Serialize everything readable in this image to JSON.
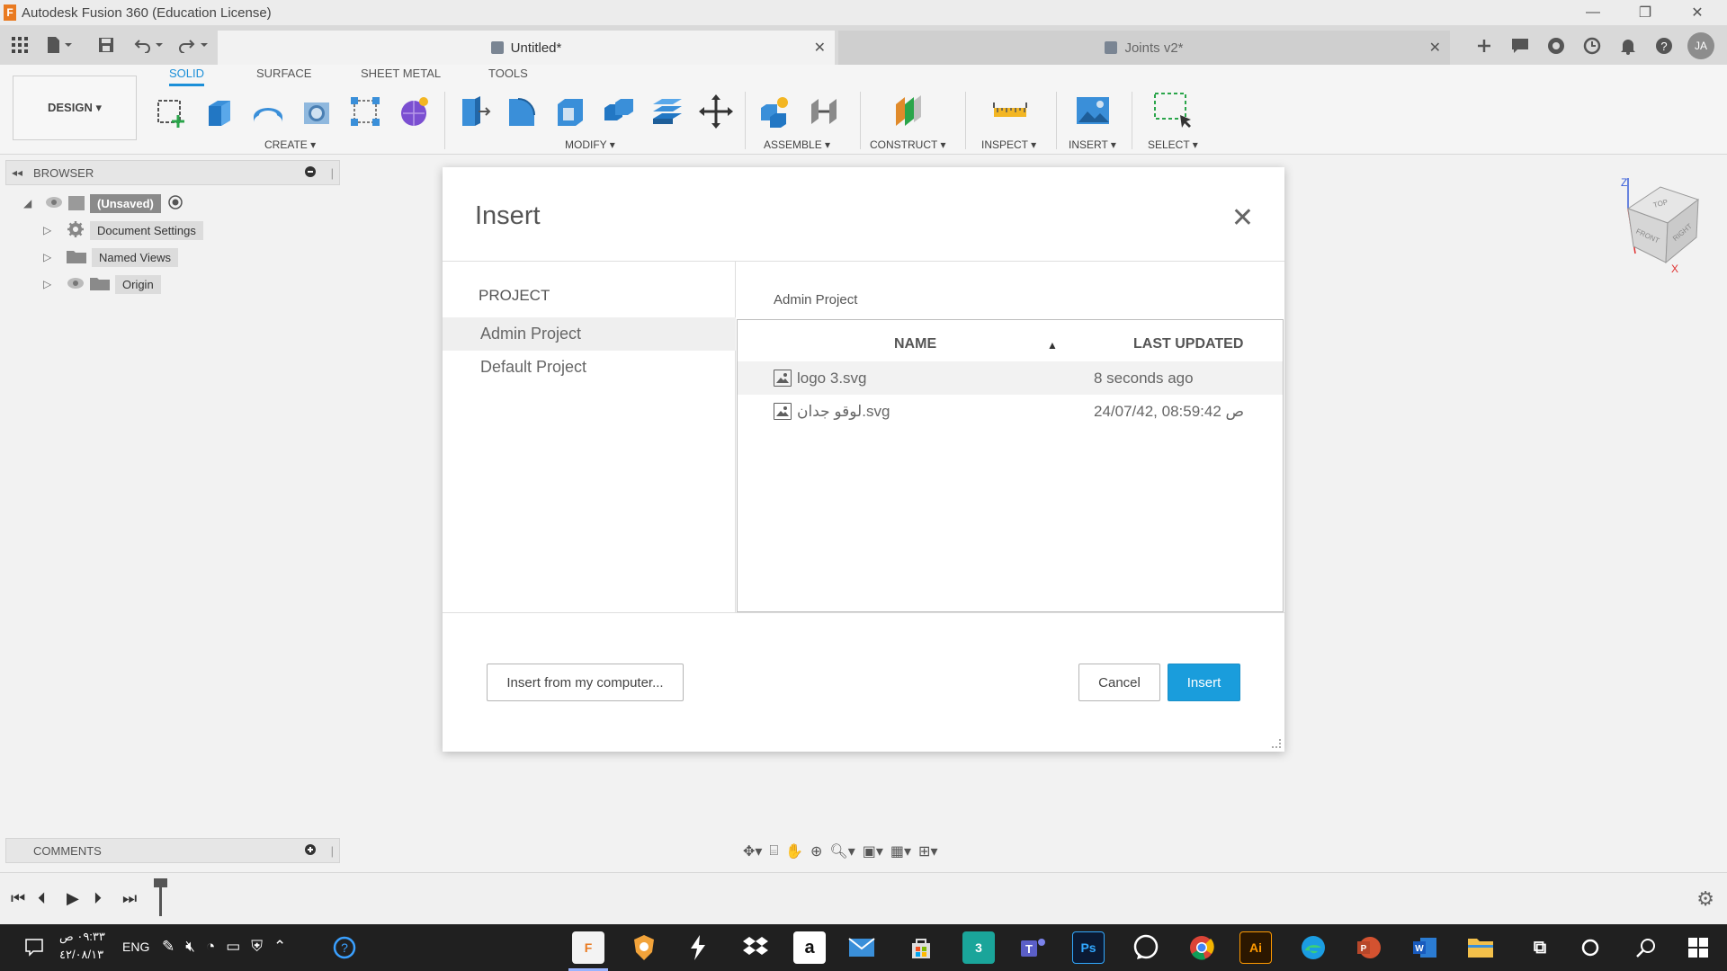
{
  "window": {
    "title": "Autodesk Fusion 360 (Education License)",
    "app_logo_letter": "F",
    "controls": {
      "minimize": "—",
      "restore": "❐",
      "close": "✕"
    }
  },
  "tabs": [
    {
      "label": "Untitled*",
      "active": true
    },
    {
      "label": "Joints v2*",
      "active": false
    }
  ],
  "tab_close": "✕",
  "user_initials": "JA",
  "toolbar": {
    "design_label": "DESIGN ▾",
    "workspace_tabs": [
      "SOLID",
      "SURFACE",
      "SHEET METAL",
      "TOOLS"
    ],
    "groups": {
      "create": "CREATE ▾",
      "modify": "MODIFY ▾",
      "assemble": "ASSEMBLE ▾",
      "construct": "CONSTRUCT ▾",
      "inspect": "INSPECT ▾",
      "insert": "INSERT ▾",
      "select": "SELECT ▾"
    }
  },
  "browser": {
    "title": "BROWSER",
    "root": "(Unsaved)",
    "items": [
      "Document Settings",
      "Named Views",
      "Origin"
    ]
  },
  "dialog": {
    "title": "Insert",
    "close": "✕",
    "project_header": "PROJECT",
    "projects": [
      {
        "name": "Admin Project",
        "selected": true
      },
      {
        "name": "Default Project",
        "selected": false
      }
    ],
    "breadcrumb": "Admin Project",
    "columns": {
      "name": "NAME",
      "sort_indicator": "▲",
      "updated": "LAST UPDATED"
    },
    "files": [
      {
        "name": "logo 3.svg",
        "updated": "8 seconds ago"
      },
      {
        "name": "لوقو جدان.svg",
        "updated": "24/07/42, 08:59:42 ص"
      }
    ],
    "buttons": {
      "insert_from_computer": "Insert from my computer...",
      "cancel": "Cancel",
      "insert": "Insert"
    }
  },
  "viewcube": {
    "top": "TOP",
    "front": "FRONT",
    "right": "RIGHT",
    "axis_z": "Z",
    "axis_x": "X"
  },
  "comments": {
    "title": "COMMENTS"
  },
  "taskbar": {
    "time": "٠٩:٣٣ ص",
    "date": "٤٢/٠٨/١٣",
    "language": "ENG",
    "apps": [
      "F",
      "Ps",
      "Ai",
      "3"
    ]
  },
  "colors": {
    "accent": "#1a9ddc",
    "taskbar": "#202020"
  }
}
